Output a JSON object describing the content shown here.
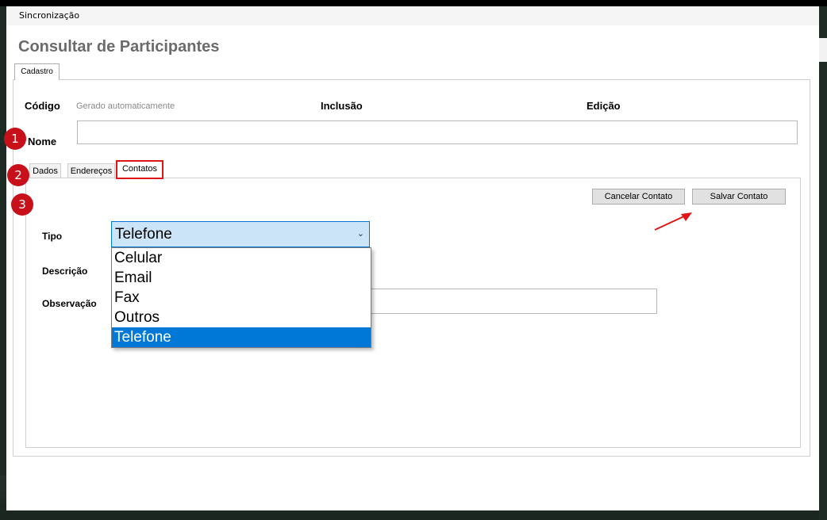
{
  "window": {
    "title": "Sincronização"
  },
  "page": {
    "title": "Consultar de Participantes"
  },
  "tabs": {
    "cadastro": "Cadastro"
  },
  "cadastro": {
    "codigo_label": "Código",
    "codigo_value": "Gerado automaticamente",
    "inclusao_label": "Inclusão",
    "edicao_label": "Edição",
    "nome_label": "Nome",
    "nome_value": ""
  },
  "inner_tabs": [
    "Dados",
    "Endereços",
    "Contatos"
  ],
  "contatos": {
    "cancel_label": "Cancelar Contato",
    "save_label": "Salvar Contato",
    "markers": [
      "1",
      "2",
      "3"
    ],
    "tipo_label": "Tipo",
    "descricao_label": "Descrição",
    "observacao_label": "Observação",
    "tipo_value": "Telefone",
    "tipo_options": [
      "Celular",
      "Email",
      "Fax",
      "Outros",
      "Telefone"
    ],
    "tipo_selected_index": 4,
    "observacao_value": ""
  },
  "colors": {
    "accent": "#0078d7",
    "marker": "#c8101a",
    "highlight_border": "#e01515",
    "arrow": "#e01515"
  },
  "icons": {
    "dropdown": "chevron-down-icon",
    "annotation": "arrow-icon"
  }
}
